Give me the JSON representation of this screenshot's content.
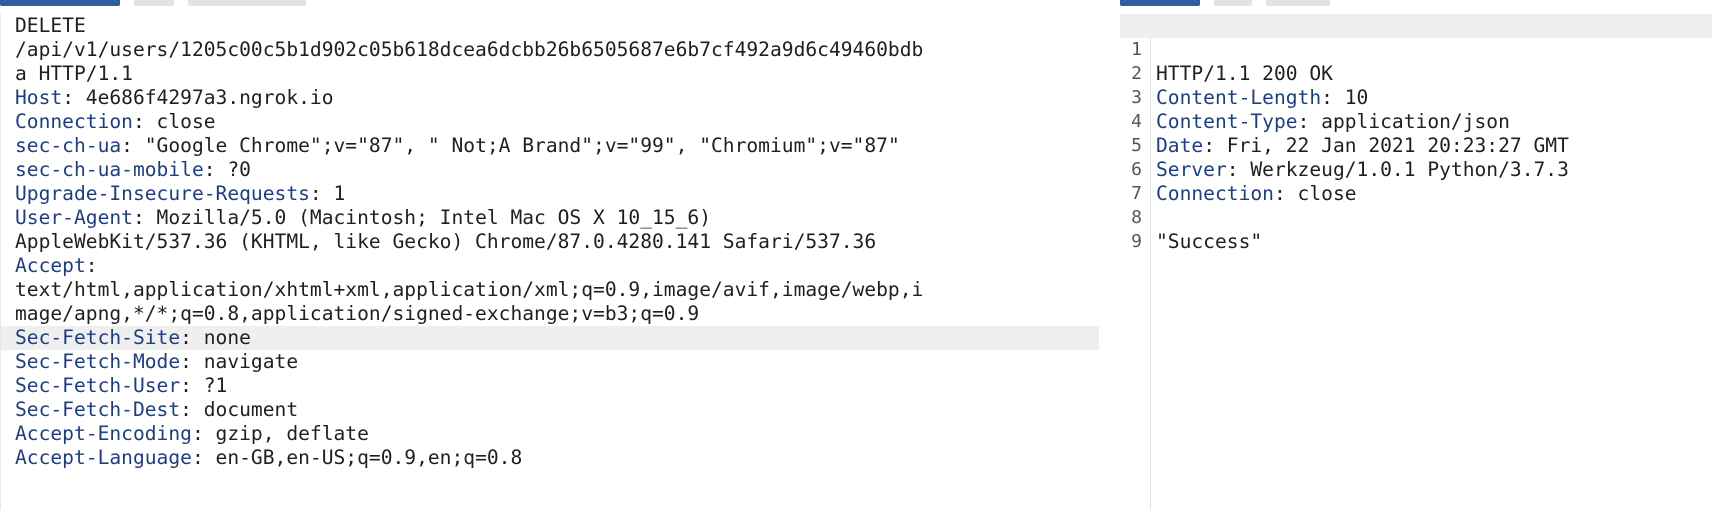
{
  "request": {
    "lines": [
      {
        "name": "",
        "value": "DELETE"
      },
      {
        "name": "",
        "value": "/api/v1/users/1205c00c5b1d902c05b618dcea6dcbb26b6505687e6b7cf492a9d6c49460bdb"
      },
      {
        "name": "",
        "value": "a HTTP/1.1"
      },
      {
        "name": "Host",
        "value": " 4e686f4297a3.ngrok.io"
      },
      {
        "name": "Connection",
        "value": " close"
      },
      {
        "name": "sec-ch-ua",
        "value": " \"Google Chrome\";v=\"87\", \" Not;A Brand\";v=\"99\", \"Chromium\";v=\"87\""
      },
      {
        "name": "sec-ch-ua-mobile",
        "value": " ?0"
      },
      {
        "name": "Upgrade-Insecure-Requests",
        "value": " 1"
      },
      {
        "name": "User-Agent",
        "value": " Mozilla/5.0 (Macintosh; Intel Mac OS X 10_15_6)"
      },
      {
        "name": "",
        "value": "AppleWebKit/537.36 (KHTML, like Gecko) Chrome/87.0.4280.141 Safari/537.36"
      },
      {
        "name": "Accept",
        "value": ""
      },
      {
        "name": "",
        "value": "text/html,application/xhtml+xml,application/xml;q=0.9,image/avif,image/webp,i"
      },
      {
        "name": "",
        "value": "mage/apng,*/*;q=0.8,application/signed-exchange;v=b3;q=0.9"
      },
      {
        "name": "Sec-Fetch-Site",
        "value": " none"
      },
      {
        "name": "Sec-Fetch-Mode",
        "value": " navigate"
      },
      {
        "name": "Sec-Fetch-User",
        "value": " ?1"
      },
      {
        "name": "Sec-Fetch-Dest",
        "value": " document"
      },
      {
        "name": "Accept-Encoding",
        "value": " gzip, deflate"
      },
      {
        "name": "Accept-Language",
        "value": " en-GB,en-US;q=0.9,en;q=0.8"
      }
    ]
  },
  "response": {
    "lines": [
      {
        "num": "1",
        "name": "",
        "value": "HTTP/1.1 200 OK"
      },
      {
        "num": "2",
        "name": "Content-Length",
        "value": " 10"
      },
      {
        "num": "3",
        "name": "Content-Type",
        "value": " application/json"
      },
      {
        "num": "4",
        "name": "Date",
        "value": " Fri, 22 Jan 2021 20:23:27 GMT"
      },
      {
        "num": "5",
        "name": "Server",
        "value": " Werkzeug/1.0.1 Python/3.7.3"
      },
      {
        "num": "6",
        "name": "Connection",
        "value": " close"
      },
      {
        "num": "7",
        "name": "",
        "value": ""
      },
      {
        "num": "8",
        "name": "",
        "value": "\"Success\""
      },
      {
        "num": "9",
        "name": "",
        "value": ""
      }
    ]
  },
  "colors": {
    "header_name": "#1f3e7c",
    "text": "#1f1f1f",
    "highlight_row": "#efefef",
    "active_tab": "#2f5f9e"
  }
}
